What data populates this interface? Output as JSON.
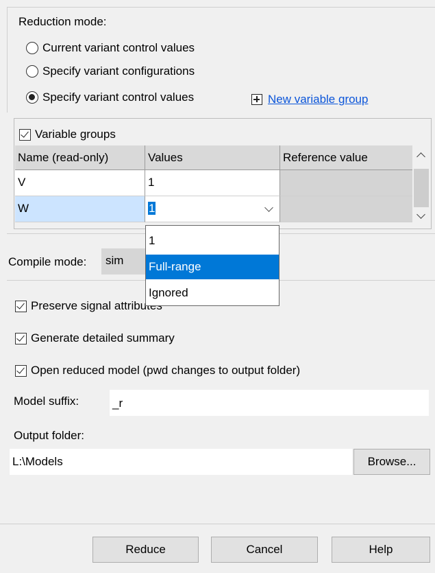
{
  "reduction_mode": {
    "label": "Reduction mode:",
    "options": [
      {
        "label": "Current variant control values",
        "selected": false
      },
      {
        "label": "Specify variant configurations",
        "selected": false
      },
      {
        "label": "Specify variant control values",
        "selected": true
      }
    ],
    "new_group_link": "New variable group"
  },
  "variable_groups": {
    "checkbox_label": "Variable groups",
    "checked": true,
    "columns": [
      "Name (read-only)",
      "Values",
      "Reference value"
    ],
    "rows": [
      {
        "name": "V",
        "value": "1",
        "reference": ""
      },
      {
        "name": "W",
        "value": "1",
        "reference": ""
      }
    ],
    "dropdown_options": [
      "1",
      "Full-range",
      "Ignored"
    ],
    "dropdown_highlighted": "Full-range"
  },
  "compile_mode": {
    "label": "Compile mode:",
    "value": "sim"
  },
  "options": {
    "preserve_signal": "Preserve signal attributes",
    "detailed_summary": "Generate detailed summary",
    "open_reduced": "Open reduced model (pwd changes to output folder)"
  },
  "model_suffix": {
    "label": "Model suffix:",
    "value": "_r"
  },
  "output_folder": {
    "label": "Output folder:",
    "value": "L:\\Models",
    "browse": "Browse..."
  },
  "buttons": {
    "reduce": "Reduce",
    "cancel": "Cancel",
    "help": "Help"
  },
  "colors": {
    "selection": "#0078d7",
    "link": "#0b55d9",
    "background": "#f0f0f0"
  }
}
